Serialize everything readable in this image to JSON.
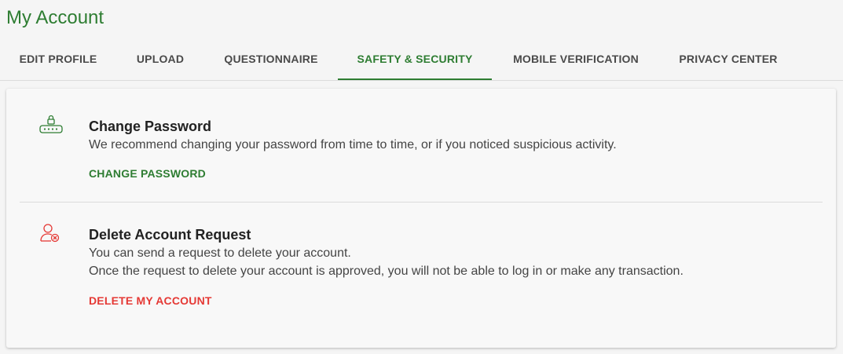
{
  "page": {
    "title": "My Account"
  },
  "tabs": [
    {
      "label": "EDIT PROFILE"
    },
    {
      "label": "UPLOAD"
    },
    {
      "label": "QUESTIONNAIRE"
    },
    {
      "label": "SAFETY & SECURITY",
      "active": true
    },
    {
      "label": "MOBILE VERIFICATION"
    },
    {
      "label": "PRIVACY CENTER"
    }
  ],
  "sections": {
    "change_password": {
      "icon": "password-lock-icon",
      "title": "Change Password",
      "description": "We recommend changing your password from time to time, or if you noticed suspicious activity.",
      "action_label": "CHANGE PASSWORD"
    },
    "delete_account": {
      "icon": "delete-user-icon",
      "title": "Delete Account Request",
      "description_line1": "You can send a request to delete your account.",
      "description_line2": "Once the request to delete your account is approved, you will not be able to log in or make any transaction.",
      "action_label": "DELETE MY ACCOUNT"
    }
  },
  "colors": {
    "accent": "#2e7d32",
    "danger": "#e53935",
    "text": "#222222",
    "muted": "#444444"
  }
}
